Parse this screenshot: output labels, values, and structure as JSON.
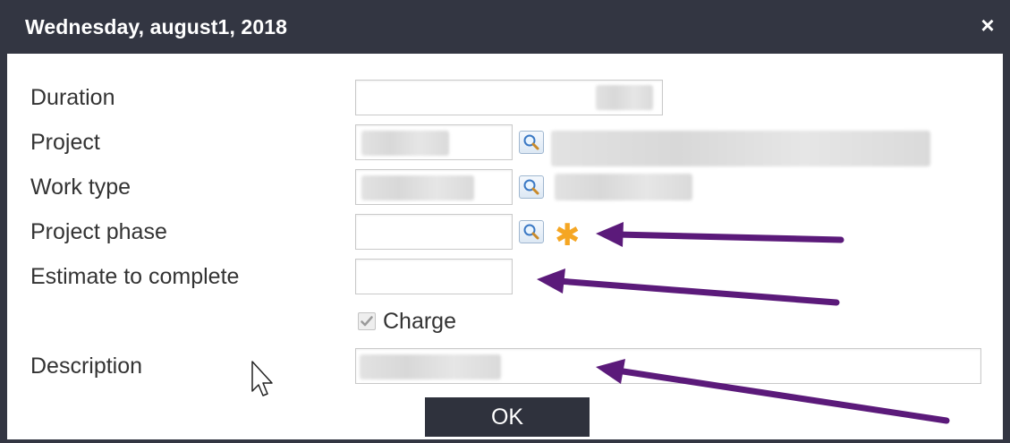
{
  "dialog": {
    "title": "Wednesday, august1, 2018",
    "close_symbol": "×"
  },
  "form": {
    "duration_label": "Duration",
    "project_label": "Project",
    "work_type_label": "Work type",
    "project_phase_label": "Project phase",
    "estimate_label": "Estimate to complete",
    "description_label": "Description",
    "required_marker": "✱",
    "charge_label": "Charge",
    "charge_checked": true,
    "ok_label": "OK"
  },
  "icons": {
    "lookup": "magnifier-icon",
    "checkbox": "checkmark-icon",
    "arrow": "annotation-arrow",
    "cursor": "mouse-pointer-icon"
  },
  "colors": {
    "titlebar": "#333642",
    "required": "#f5a623",
    "annotation_arrow": "#5b1a7a",
    "ok_button": "#2f323d"
  }
}
